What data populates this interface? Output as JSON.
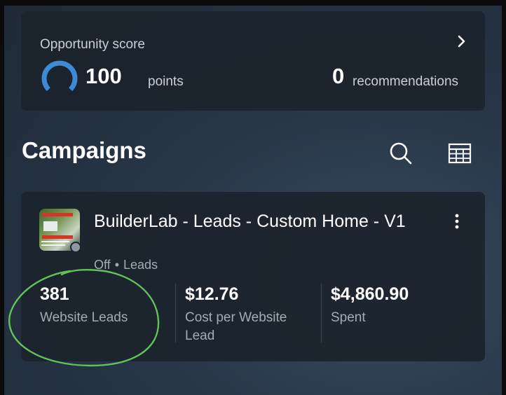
{
  "opportunity": {
    "title": "Opportunity score",
    "score_value": "100",
    "score_unit": "points",
    "score_level": 1.0,
    "recommendations_value": "0",
    "recommendations_unit": "recommendations"
  },
  "campaigns": {
    "title": "Campaigns",
    "items": [
      {
        "name": "BuilderLab - Leads - Custom Home - V1",
        "status": "Off",
        "objective": "Leads",
        "metrics": [
          {
            "value": "381",
            "label": "Website Leads"
          },
          {
            "value": "$12.76",
            "label": "Cost per Website Lead"
          },
          {
            "value": "$4,860.90",
            "label": "Spent"
          }
        ]
      }
    ]
  },
  "colors": {
    "gauge": "#3d8ad6",
    "annotation_circle": "#62c25a"
  },
  "icons": [
    "chevron-right-icon",
    "search-icon",
    "table-icon",
    "more-vertical-icon"
  ]
}
